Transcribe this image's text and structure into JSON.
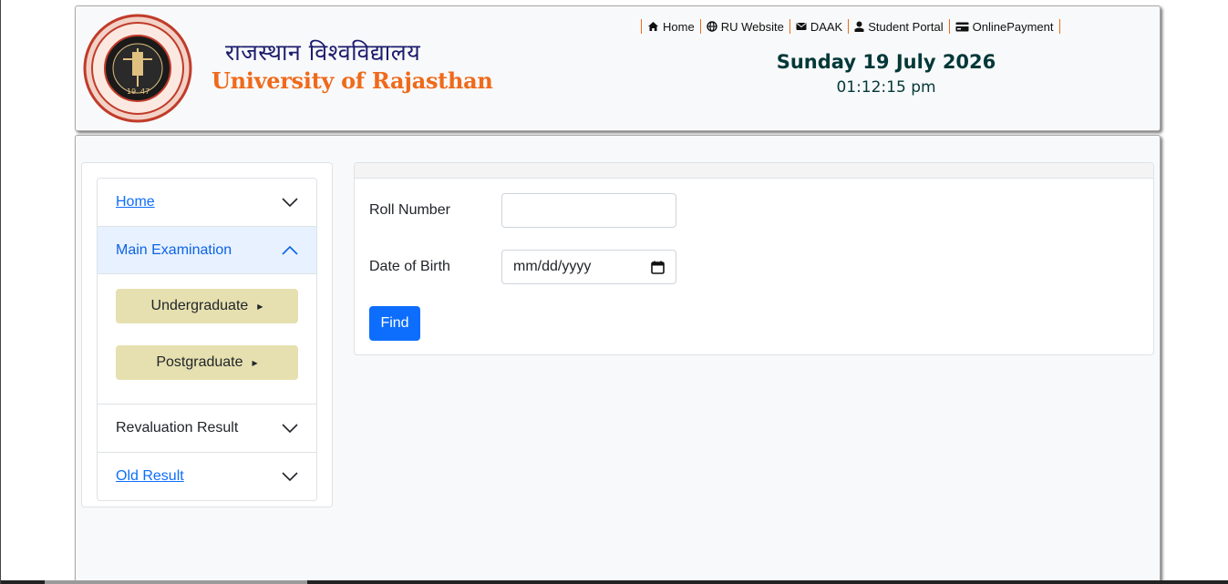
{
  "header": {
    "brand_hindi": "राजस्थान विश्वविद्यालय",
    "brand_english": "University of Rajasthan",
    "seal_year": "1947",
    "nav": [
      {
        "label": "Home",
        "icon": "home-icon"
      },
      {
        "label": "RU Website",
        "icon": "globe-icon"
      },
      {
        "label": "DAAK",
        "icon": "envelope-icon"
      },
      {
        "label": "Student Portal",
        "icon": "student-icon"
      },
      {
        "label": "OnlinePayment",
        "icon": "card-icon"
      }
    ],
    "date": "Sunday 19 July 2026",
    "time": "01:12:15 pm"
  },
  "sidebar": {
    "items": [
      {
        "label": "Home",
        "icon": "chevron-down-icon"
      },
      {
        "label": "Main Examination",
        "icon": "chevron-up-icon"
      },
      {
        "label": "Revaluation Result",
        "icon": "chevron-down-icon"
      },
      {
        "label": "Old Result",
        "icon": "chevron-down-icon"
      }
    ],
    "buttons": [
      {
        "label": "Undergraduate",
        "icon": "caret-right-icon"
      },
      {
        "label": "Postgraduate",
        "icon": "caret-right-icon"
      }
    ]
  },
  "form": {
    "roll_label": "Roll Number",
    "roll_value": "",
    "dob_label": "Date of Birth",
    "dob_placeholder": "mm/dd/yyyy",
    "find_label": "Find"
  },
  "colors": {
    "brand_hindi": "#1c1c6e",
    "brand_english": "#ef6a1b",
    "date": "#043838",
    "active_accordion_bg": "#e7f1ff",
    "level_button_bg": "#e6e0b0",
    "primary": "#0d6efd"
  }
}
